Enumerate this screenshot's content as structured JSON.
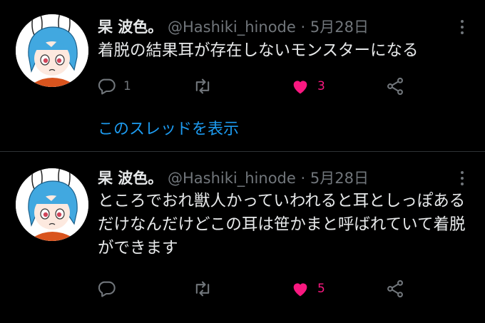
{
  "tweets": [
    {
      "name": "杲 波色。",
      "handle": "@Hashiki_hinode",
      "separator": "·",
      "date": "5月28日",
      "text": "着脱の結果耳が存在しないモンスターになる",
      "replies": "1",
      "retweets": "",
      "likes": "3",
      "liked": true
    },
    {
      "name": "杲 波色。",
      "handle": "@Hashiki_hinode",
      "separator": "·",
      "date": "5月28日",
      "text": "ところでおれ獣人かっていわれると耳としっぽあるだけなんだけどこの耳は笹かまと呼ばれていて着脱ができます",
      "replies": "",
      "retweets": "",
      "likes": "5",
      "liked": true
    }
  ],
  "thread_link": "このスレッドを表示",
  "colors": {
    "like": "#f91880",
    "link": "#1d9bf0",
    "muted": "#71767b"
  }
}
